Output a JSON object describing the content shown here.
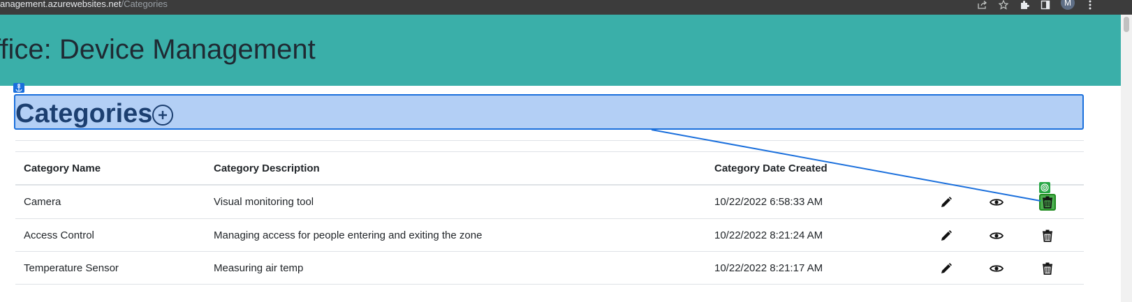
{
  "browser": {
    "url_host": "anagement.azurewebsites.net",
    "url_path": "/Categories",
    "avatar_initial": "M",
    "icons": [
      "share-icon",
      "star-icon",
      "extensions-icon",
      "sidebar-icon",
      "avatar",
      "kebab-menu-icon"
    ]
  },
  "header": {
    "title": "ffice: Device Management",
    "background": "#3aafa9"
  },
  "section": {
    "title": "Categories",
    "add_icon": "plus-circle-icon",
    "highlight_color": "#b3cff5",
    "outline_color": "#1a6fdc"
  },
  "table": {
    "columns": [
      "Category Name",
      "Category Description",
      "Category Date Created"
    ],
    "rows": [
      {
        "name": "Camera",
        "description": "Visual monitoring tool",
        "date_created": "10/22/2022 6:58:33 AM"
      },
      {
        "name": "Access Control",
        "description": "Managing access for people entering and exiting the zone",
        "date_created": "10/22/2022 8:21:24 AM"
      },
      {
        "name": "Temperature Sensor",
        "description": "Measuring air temp",
        "date_created": "10/22/2022 8:21:17 AM"
      }
    ],
    "row_actions": [
      "edit-pencil-icon",
      "view-eye-icon",
      "delete-trash-icon"
    ]
  },
  "annotation": {
    "target_color": "#4caf50",
    "connector_color": "#1a6fdc"
  }
}
